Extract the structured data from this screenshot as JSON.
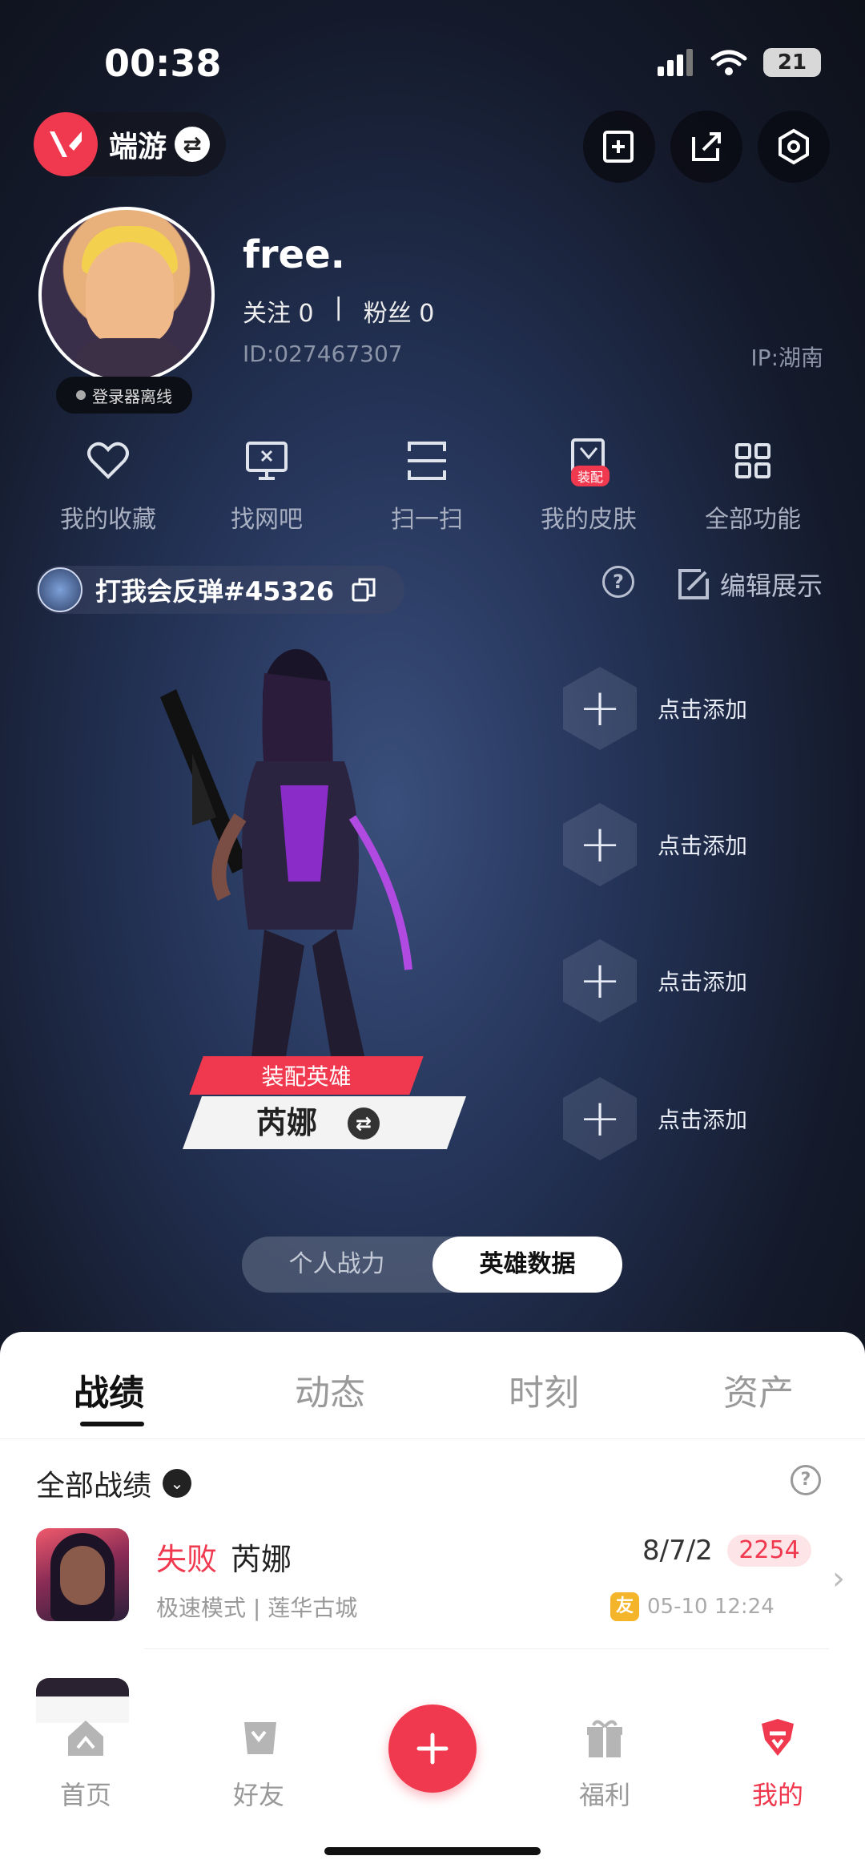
{
  "status_bar": {
    "time": "00:38",
    "battery": "21"
  },
  "header": {
    "app_name": "端游",
    "username": "free.",
    "following_label": "关注 0",
    "followers_label": "粉丝 0",
    "separator": "|",
    "user_id": "ID:027467307",
    "ip": "IP:湖南",
    "online_status": "登录器离线"
  },
  "menu": [
    {
      "label": "我的收藏",
      "icon": "heart-icon"
    },
    {
      "label": "找网吧",
      "icon": "monitor-icon"
    },
    {
      "label": "扫一扫",
      "icon": "scan-icon"
    },
    {
      "label": "我的皮肤",
      "icon": "skin-icon",
      "badge": "装配"
    },
    {
      "label": "全部功能",
      "icon": "grid-icon"
    }
  ],
  "riot": {
    "name": "打我会反弹#45326",
    "edit_label": "编辑展示"
  },
  "hero": {
    "equip_label": "装配英雄",
    "agent_name": "芮娜",
    "slots": [
      "点击添加",
      "点击添加",
      "点击添加",
      "点击添加"
    ]
  },
  "toggle": {
    "left": "个人战力",
    "right": "英雄数据",
    "active": "right"
  },
  "tabs": [
    {
      "label": "战绩",
      "active": true
    },
    {
      "label": "动态",
      "active": false
    },
    {
      "label": "时刻",
      "active": false
    },
    {
      "label": "资产",
      "active": false
    }
  ],
  "records": {
    "filter_label": "全部战绩",
    "items": [
      {
        "result": "失败",
        "agent": "芮娜",
        "mode": "极速模式 | 莲华古城",
        "kda": "8/7/2",
        "score": "2254",
        "friend_badge": "友",
        "time": "05-10 12:24"
      }
    ]
  },
  "bottom_nav": [
    {
      "label": "首页",
      "icon": "home-icon",
      "active": false
    },
    {
      "label": "好友",
      "icon": "friends-icon",
      "active": false
    },
    {
      "label": "福利",
      "icon": "gift-icon",
      "active": false
    },
    {
      "label": "我的",
      "icon": "profile-icon",
      "active": true
    }
  ],
  "colors": {
    "accent": "#f0394f",
    "bg": "#14161f",
    "sheet": "#ffffff"
  }
}
